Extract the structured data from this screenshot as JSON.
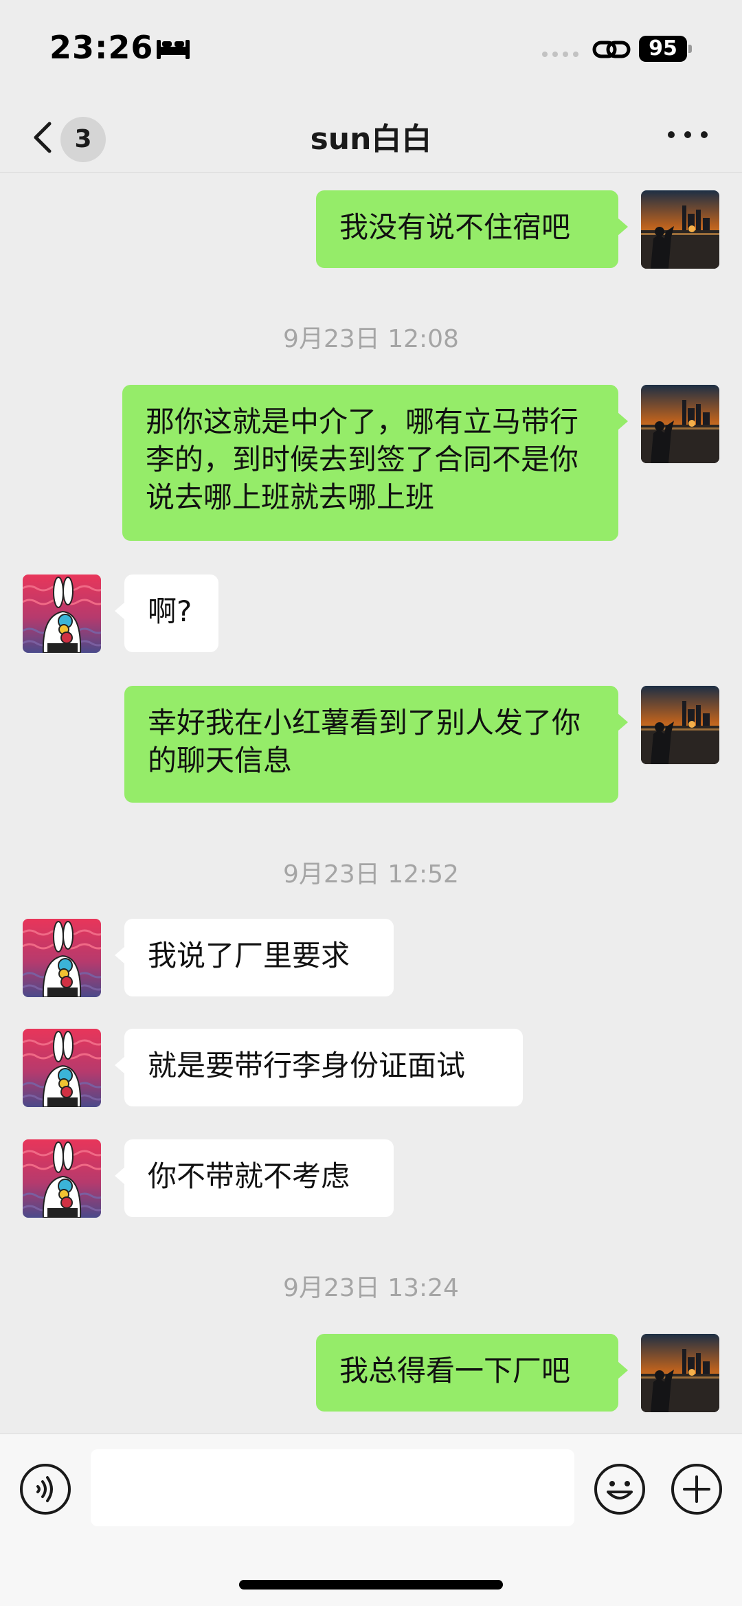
{
  "status_bar": {
    "time": "23:26",
    "battery": "95",
    "icons": [
      "sleep-bed-icon",
      "signal-dots-icon",
      "link-icon",
      "battery-icon"
    ]
  },
  "nav": {
    "title": "sun白白",
    "unread_count": "3",
    "icons": [
      "chevron-left-icon",
      "more-dots-icon"
    ]
  },
  "messages": [
    {
      "from": "me",
      "text": "我没有说不住宿吧"
    },
    {
      "time": "9月23日 12:08"
    },
    {
      "from": "me",
      "text": "那你这就是中介了，哪有立马带行李的，到时候去到签了合同不是你说去哪上班就去哪上班"
    },
    {
      "from": "other",
      "text": "啊?"
    },
    {
      "from": "me",
      "text": "幸好我在小红薯看到了别人发了你的聊天信息"
    },
    {
      "time": "9月23日 12:52"
    },
    {
      "from": "other",
      "text": "我说了厂里要求"
    },
    {
      "from": "other",
      "text": "就是要带行李身份证面试"
    },
    {
      "from": "other",
      "text": "你不带就不考虑"
    },
    {
      "time": "9月23日 13:24"
    },
    {
      "from": "me",
      "text": "我总得看一下厂吧"
    }
  ],
  "input_bar": {
    "text_value": "",
    "icons": [
      "voice-icon",
      "emoji-icon",
      "plus-icon"
    ]
  },
  "colors": {
    "sent_bubble": "#95ec69",
    "received_bubble": "#ffffff",
    "background": "#ededed",
    "timestamp_text": "#a5a5a5"
  }
}
